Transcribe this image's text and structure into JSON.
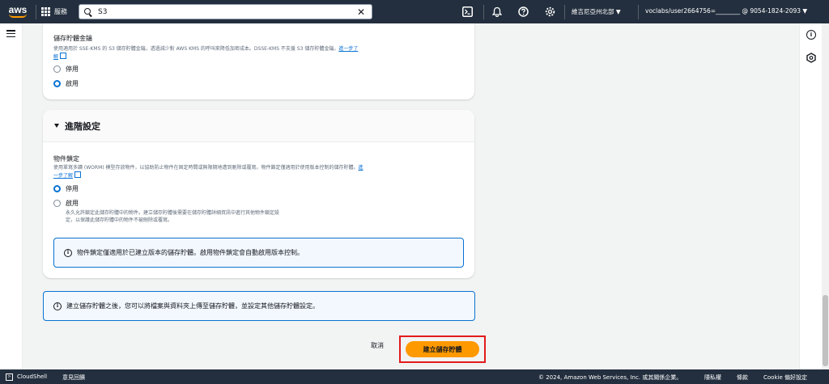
{
  "nav": {
    "logo": "aws",
    "services_label": "服務",
    "search_value": "S3",
    "region": "維吉尼亞州北部 ▼",
    "account": "voclabs/user2664756=________ @ 9054-1824-2093 ▼"
  },
  "bucket_key": {
    "title": "儲存貯體金鑰",
    "desc": "使用適用於 SSE-KMS 的 S3 儲存貯體金鑰，透過減少對 AWS KMS 的呼叫來降低加密成本。DSSE-KMS 不支援 S3 儲存貯體金鑰。",
    "learn_more": "進一步了",
    "learn_more_2": "解",
    "opt_disable": "停用",
    "opt_enable": "啟用"
  },
  "advanced": {
    "title": "進階設定",
    "object_lock_title": "物件鎖定",
    "object_lock_desc": "使用單寫多讀 (WORM) 模型存放物件，以協助防止物件在固定時間或無限期地遭到刪除或覆寫。物件鎖定僅適用於使用版本控制的儲存貯體。",
    "learn_more": "進",
    "learn_more_2": "一步了解",
    "opt_disable": "停用",
    "opt_enable": "啟用",
    "enable_hint_1": "永久允許鎖定此儲存貯體中的物件。建立儲存貯體後需要在儲存貯體詳細資訊中進行其他物件鎖定設",
    "enable_hint_2": "定，以保護此儲存貯體中的物件不被刪除或覆寫。",
    "info": "物件鎖定僅適用於已建立版本的儲存貯體。啟用物件鎖定會自動啟用版本控制。"
  },
  "after_create_info": "建立儲存貯體之後，您可以將檔案與資料夾上傳至儲存貯體，並設定其他儲存貯體設定。",
  "actions": {
    "cancel": "取消",
    "create": "建立儲存貯體"
  },
  "footer": {
    "cloudshell": "CloudShell",
    "feedback": "意見回饋",
    "copyright": "© 2024, Amazon Web Services, Inc. 或其關係企業。",
    "privacy": "隱私權",
    "terms": "條款",
    "cookie": "Cookie 偏好設定"
  }
}
